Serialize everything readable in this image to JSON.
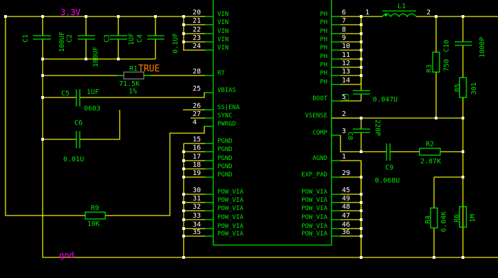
{
  "colors": {
    "wire": "#f0f000",
    "component": "#00e000",
    "pin_number": "#ffffff",
    "net_label": "#ff00ff",
    "attribute": "#ff8000",
    "r1_body": "#808080",
    "background": "#000000"
  },
  "nets": {
    "vin": "3.3V",
    "gnd": "gnd"
  },
  "ic": {
    "left_pins": [
      {
        "num": "20",
        "name": "VIN"
      },
      {
        "num": "21",
        "name": "VIN"
      },
      {
        "num": "22",
        "name": "VIN"
      },
      {
        "num": "23",
        "name": "VIN"
      },
      {
        "num": "24",
        "name": "VIN"
      },
      {
        "num": "28",
        "name": "RT"
      },
      {
        "num": "25",
        "name": "VBIAS"
      },
      {
        "num": "26",
        "name": "SS|ENA"
      },
      {
        "num": "27",
        "name": "SYNC"
      },
      {
        "num": "4",
        "name": "PWRGD"
      },
      {
        "num": "15",
        "name": "PGND"
      },
      {
        "num": "16",
        "name": "PGND"
      },
      {
        "num": "17",
        "name": "PGND"
      },
      {
        "num": "18",
        "name": "PGND"
      },
      {
        "num": "19",
        "name": "PGND"
      },
      {
        "num": "30",
        "name": "POW_VIA"
      },
      {
        "num": "31",
        "name": "POW_VIA"
      },
      {
        "num": "32",
        "name": "POW_VIA"
      },
      {
        "num": "33",
        "name": "POW_VIA"
      },
      {
        "num": "34",
        "name": "POW_VIA"
      },
      {
        "num": "35",
        "name": "POW_VIA"
      }
    ],
    "right_pins": [
      {
        "num": "6",
        "name": "PH"
      },
      {
        "num": "7",
        "name": "PH"
      },
      {
        "num": "8",
        "name": "PH"
      },
      {
        "num": "9",
        "name": "PH"
      },
      {
        "num": "10",
        "name": "PH"
      },
      {
        "num": "11",
        "name": "PH"
      },
      {
        "num": "12",
        "name": "PH"
      },
      {
        "num": "13",
        "name": "PH"
      },
      {
        "num": "14",
        "name": "PH"
      },
      {
        "num": "5",
        "name": "BOOT"
      },
      {
        "num": "2",
        "name": "VSENSE"
      },
      {
        "num": "3",
        "name": "COMP"
      },
      {
        "num": "1",
        "name": "AGND"
      },
      {
        "num": "29",
        "name": "EXP_PAD"
      },
      {
        "num": "45",
        "name": "POW_VIA"
      },
      {
        "num": "49",
        "name": "POW_VIA"
      },
      {
        "num": "48",
        "name": "POW_VIA"
      },
      {
        "num": "47",
        "name": "POW_VIA"
      },
      {
        "num": "46",
        "name": "POW_VIA"
      },
      {
        "num": "36",
        "name": "POW_VIA"
      }
    ]
  },
  "components": {
    "c1": {
      "ref": "C1",
      "value": "100UF"
    },
    "c2": {
      "ref": "C2",
      "value": "100UF"
    },
    "c3": {
      "ref": "C3",
      "value": "1UF"
    },
    "c4": {
      "ref": "C4",
      "value": "0.1UF"
    },
    "r1": {
      "ref": "R1",
      "attr": "TRUE",
      "value": "71.5K",
      "tol": "1%"
    },
    "c5": {
      "ref": "C5",
      "value": "1UF",
      "pkg": "0603"
    },
    "c6": {
      "ref": "C6",
      "value": "0.01U"
    },
    "r9": {
      "ref": "R9",
      "value": "10K"
    },
    "l1": {
      "ref": "L1",
      "pin1": "1",
      "pin2": "2"
    },
    "c7": {
      "ref": "C7",
      "value": "0.047U"
    },
    "r3": {
      "ref": "R3",
      "value": "750"
    },
    "c10": {
      "ref": "C10",
      "value": "1000P"
    },
    "r5": {
      "ref": "R5",
      "value": "301"
    },
    "c8": {
      "ref": "C8",
      "value": "220P"
    },
    "c9": {
      "ref": "C9",
      "value": "0.068U"
    },
    "r2": {
      "ref": "R2",
      "value": "2.87K"
    },
    "r4": {
      "ref": "R4",
      "value": "6.04K"
    },
    "r6": {
      "ref": "R6",
      "value": "1M"
    }
  }
}
